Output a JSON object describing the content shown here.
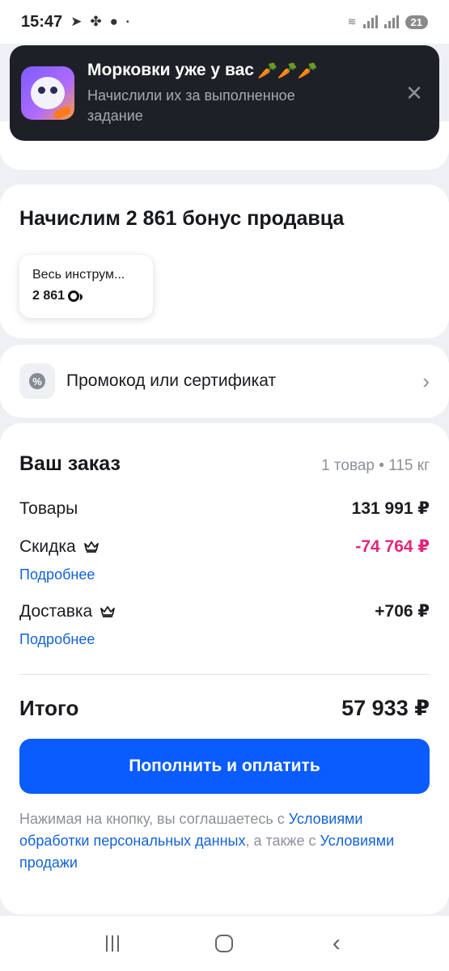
{
  "status_bar": {
    "time": "15:47",
    "battery": "21",
    "icons": [
      "telegram-icon",
      "fan-icon",
      "chat-icon",
      "dot-icon",
      "wifi-icon",
      "signal-icon"
    ]
  },
  "toast": {
    "title": "Морковки уже у вас",
    "carrots": "🥕🥕🥕",
    "subtitle": "Начислили их за выполненное задание",
    "close": "✕"
  },
  "bonus": {
    "title": "Начислим 2 861 бонус продавца",
    "chip_label": "Весь инструм...",
    "chip_value": "2 861"
  },
  "promo": {
    "label": "Промокод или сертификат",
    "chevron": "›"
  },
  "order": {
    "title": "Ваш заказ",
    "meta": "1 товар • 115 кг",
    "goods_label": "Товары",
    "goods_amount": "131 991 ₽",
    "discount_label": "Скидка",
    "discount_amount": "-74 764 ₽",
    "discount_more": "Подробнее",
    "delivery_label": "Доставка",
    "delivery_amount": "+706 ₽",
    "delivery_more": "Подробнее",
    "total_label": "Итого",
    "total_amount": "57 933 ₽",
    "pay_button": "Пополнить и оплатить",
    "legal_prefix": "Нажимая на кнопку, вы соглашаетесь с ",
    "legal_link1": "Условиями обработки персональных данных",
    "legal_mid": ", а также с ",
    "legal_link2": "Условиями продажи"
  },
  "colors": {
    "accent": "#0a5cff",
    "discount": "#e0267a",
    "link": "#1262d6",
    "toast_bg": "#1e2027"
  }
}
